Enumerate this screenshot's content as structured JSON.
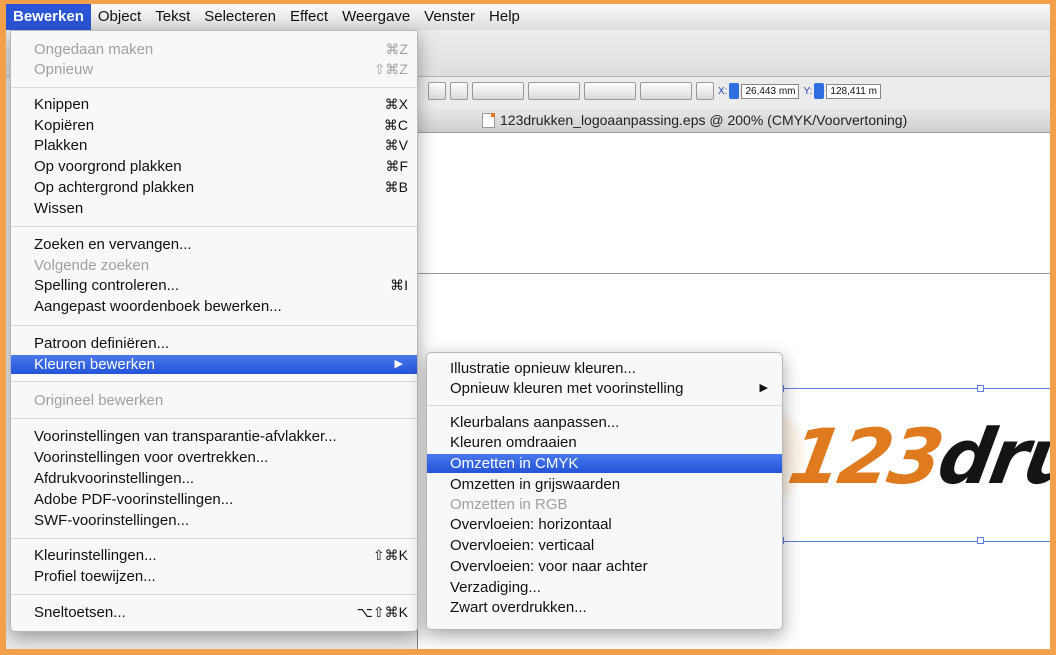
{
  "menubar": {
    "items": [
      "Bewerken",
      "Object",
      "Tekst",
      "Selecteren",
      "Effect",
      "Weergave",
      "Venster",
      "Help"
    ]
  },
  "toolbar": {
    "x_label": "X:",
    "x_value": "26,443 mm",
    "y_label": "Y:",
    "y_value": "128,411 m"
  },
  "document": {
    "tab_title": "123drukken_logoaanpassing.eps @ 200% (CMYK/Voorvertoning)"
  },
  "artwork": {
    "logo_number": "123",
    "logo_text": "dru",
    "logo_colors": {
      "number": "#e07a1f",
      "text": "#141414"
    }
  },
  "edit_menu": {
    "undo": "Ongedaan maken",
    "undo_sc": "⌘Z",
    "redo": "Opnieuw",
    "redo_sc": "⇧⌘Z",
    "cut": "Knippen",
    "cut_sc": "⌘X",
    "copy": "Kopiëren",
    "copy_sc": "⌘C",
    "paste": "Plakken",
    "paste_sc": "⌘V",
    "paste_front": "Op voorgrond plakken",
    "paste_front_sc": "⌘F",
    "paste_back": "Op achtergrond plakken",
    "paste_back_sc": "⌘B",
    "clear": "Wissen",
    "find_replace": "Zoeken en vervangen...",
    "find_next": "Volgende zoeken",
    "spelling": "Spelling controleren...",
    "spelling_sc": "⌘I",
    "custom_dict": "Aangepast woordenboek bewerken...",
    "define_pattern": "Patroon definiëren...",
    "edit_colors": "Kleuren bewerken",
    "edit_original": "Origineel bewerken",
    "transparency_presets": "Voorinstellingen van transparantie-afvlakker...",
    "tracing_presets": "Voorinstellingen voor overtrekken...",
    "print_presets": "Afdrukvoorinstellingen...",
    "pdf_presets": "Adobe PDF-voorinstellingen...",
    "swf_presets": "SWF-voorinstellingen...",
    "color_settings": "Kleurinstellingen...",
    "color_settings_sc": "⇧⌘K",
    "assign_profile": "Profiel toewijzen...",
    "shortcuts": "Sneltoetsen...",
    "shortcuts_sc": "⌥⇧⌘K"
  },
  "colors_submenu": {
    "recolor": "Illustratie opnieuw kleuren...",
    "recolor_preset": "Opnieuw kleuren met voorinstelling",
    "adjust_balance": "Kleurbalans aanpassen...",
    "invert": "Kleuren omdraaien",
    "to_cmyk": "Omzetten in CMYK",
    "to_grayscale": "Omzetten in grijswaarden",
    "to_rgb": "Omzetten in RGB",
    "blend_horizontal": "Overvloeien: horizontaal",
    "blend_vertical": "Overvloeien: verticaal",
    "blend_front_back": "Overvloeien: voor naar achter",
    "saturate": "Verzadiging...",
    "overprint_black": "Zwart overdrukken..."
  }
}
